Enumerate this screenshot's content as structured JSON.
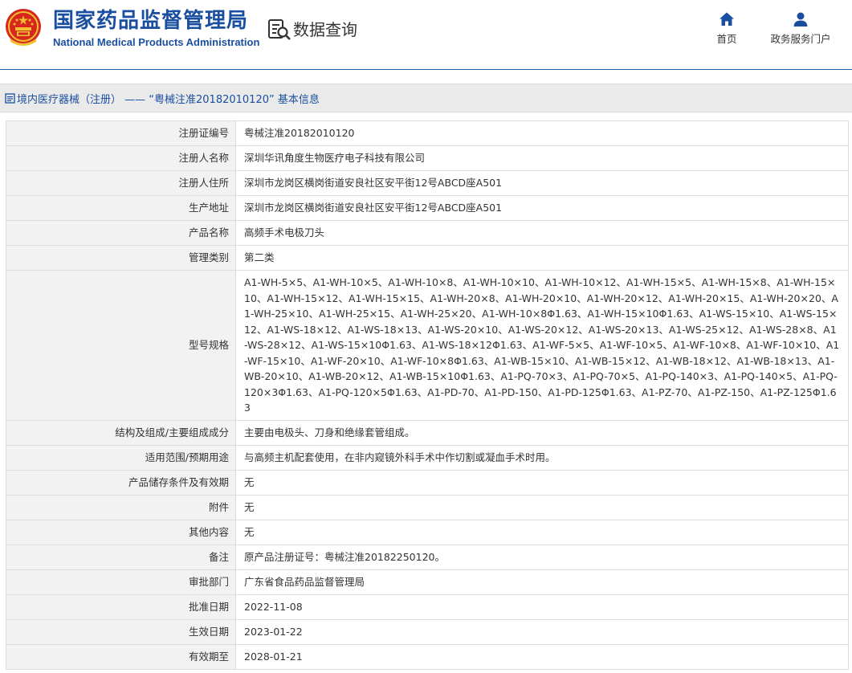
{
  "header": {
    "title_cn": "国家药品监督管理局",
    "title_en": "National Medical Products Administration",
    "data_query": "数据查询",
    "nav": [
      {
        "label": "首页",
        "icon": "home-icon"
      },
      {
        "label": "政务服务门户",
        "icon": "user-icon"
      }
    ]
  },
  "breadcrumb": {
    "text": "境内医疗器械（注册） ——  “粤械注准20182010120” 基本信息",
    "icon": "document-icon"
  },
  "colors": {
    "brand_blue": "#1a4fa0",
    "label_bg": "#f2f2f2",
    "border": "#dcdcdc",
    "crumb_bg": "#eaeaea"
  },
  "rows": [
    {
      "label": "注册证编号",
      "value": "粤械注准20182010120"
    },
    {
      "label": "注册人名称",
      "value": "深圳华讯角度生物医疗电子科技有限公司"
    },
    {
      "label": "注册人住所",
      "value": "深圳市龙岗区横岗街道安良社区安平街12号ABCD座A501"
    },
    {
      "label": "生产地址",
      "value": "深圳市龙岗区横岗街道安良社区安平街12号ABCD座A501"
    },
    {
      "label": "产品名称",
      "value": "高频手术电极刀头"
    },
    {
      "label": "管理类别",
      "value": "第二类"
    },
    {
      "label": "型号规格",
      "value": "A1-WH-5×5、A1-WH-10×5、A1-WH-10×8、A1-WH-10×10、A1-WH-10×12、A1-WH-15×5、A1-WH-15×8、A1-WH-15×10、A1-WH-15×12、A1-WH-15×15、A1-WH-20×8、A1-WH-20×10、A1-WH-20×12、A1-WH-20×15、A1-WH-20×20、A1-WH-25×10、A1-WH-25×15、A1-WH-25×20、A1-WH-10×8Φ1.63、A1-WH-15×10Φ1.63、A1-WS-15×10、A1-WS-15×12、A1-WS-18×12、A1-WS-18×13、A1-WS-20×10、A1-WS-20×12、A1-WS-20×13、A1-WS-25×12、A1-WS-28×8、A1-WS-28×12、A1-WS-15×10Φ1.63、A1-WS-18×12Φ1.63、A1-WF-5×5、A1-WF-10×5、A1-WF-10×8、A1-WF-10×10、A1-WF-15×10、A1-WF-20×10、A1-WF-10×8Φ1.63、A1-WB-15×10、A1-WB-15×12、A1-WB-18×12、A1-WB-18×13、A1-WB-20×10、A1-WB-20×12、A1-WB-15×10Φ1.63、A1-PQ-70×3、A1-PQ-70×5、A1-PQ-140×3、A1-PQ-140×5、A1-PQ-120×3Φ1.63、A1-PQ-120×5Φ1.63、A1-PD-70、A1-PD-150、A1-PD-125Φ1.63、A1-PZ-70、A1-PZ-150、A1-PZ-125Φ1.63"
    },
    {
      "label": "结构及组成/主要组成成分",
      "value": "主要由电极头、刀身和绝缘套管组成。"
    },
    {
      "label": "适用范围/预期用途",
      "value": "与高频主机配套使用，在非内窥镜外科手术中作切割或凝血手术时用。"
    },
    {
      "label": "产品储存条件及有效期",
      "value": "无"
    },
    {
      "label": "附件",
      "value": "无"
    },
    {
      "label": "其他内容",
      "value": "无"
    },
    {
      "label": "备注",
      "value": "原产品注册证号：粤械注准20182250120。"
    },
    {
      "label": "审批部门",
      "value": "广东省食品药品监督管理局"
    },
    {
      "label": "批准日期",
      "value": "2022-11-08"
    },
    {
      "label": "生效日期",
      "value": "2023-01-22"
    },
    {
      "label": "有效期至",
      "value": "2028-01-21"
    }
  ]
}
